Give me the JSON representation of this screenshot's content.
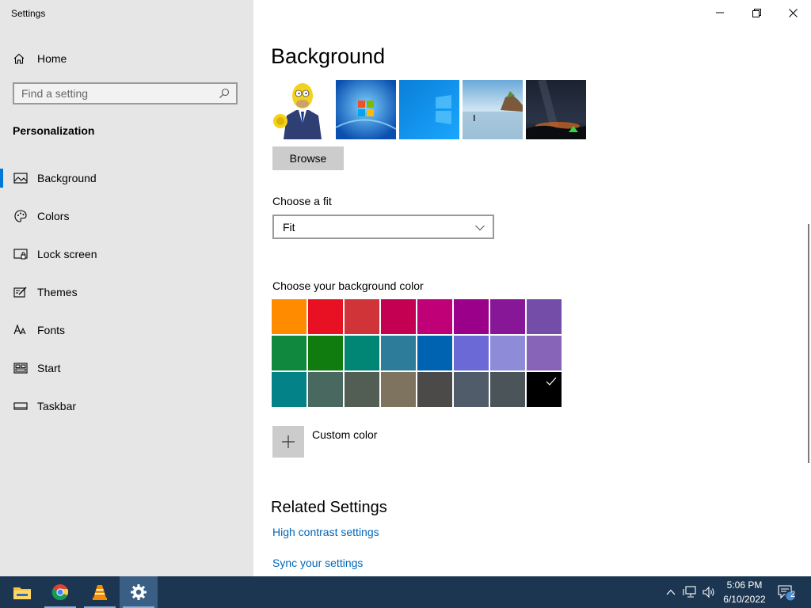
{
  "app": {
    "title": "Settings"
  },
  "sidebar": {
    "home_label": "Home",
    "search_placeholder": "Find a setting",
    "section": "Personalization",
    "items": [
      {
        "label": "Background",
        "icon": "picture-icon",
        "active": true
      },
      {
        "label": "Colors",
        "icon": "palette-icon"
      },
      {
        "label": "Lock screen",
        "icon": "lock-screen-icon"
      },
      {
        "label": "Themes",
        "icon": "themes-icon"
      },
      {
        "label": "Fonts",
        "icon": "fonts-icon"
      },
      {
        "label": "Start",
        "icon": "start-icon"
      },
      {
        "label": "Taskbar",
        "icon": "taskbar-icon"
      }
    ]
  },
  "main": {
    "title": "Background",
    "browse_label": "Browse",
    "fit_label": "Choose a fit",
    "fit_value": "Fit",
    "color_label": "Choose your background color",
    "colors": [
      "#ff8c00",
      "#e81123",
      "#d13438",
      "#c30052",
      "#bf0077",
      "#9a0089",
      "#881798",
      "#744da9",
      "#10893e",
      "#107c10",
      "#018574",
      "#2d7d9a",
      "#0063b1",
      "#6b69d6",
      "#8e8cd8",
      "#8764b8",
      "#038387",
      "#486860",
      "#525e54",
      "#7e735f",
      "#4c4a48",
      "#515c6b",
      "#4a5459",
      "#000000"
    ],
    "selected_color_index": 23,
    "custom_color_label": "Custom color",
    "related_title": "Related Settings",
    "links": [
      "High contrast settings",
      "Sync your settings"
    ]
  },
  "taskbar": {
    "time": "5:06 PM",
    "date": "6/10/2022",
    "notification_count": "2"
  }
}
